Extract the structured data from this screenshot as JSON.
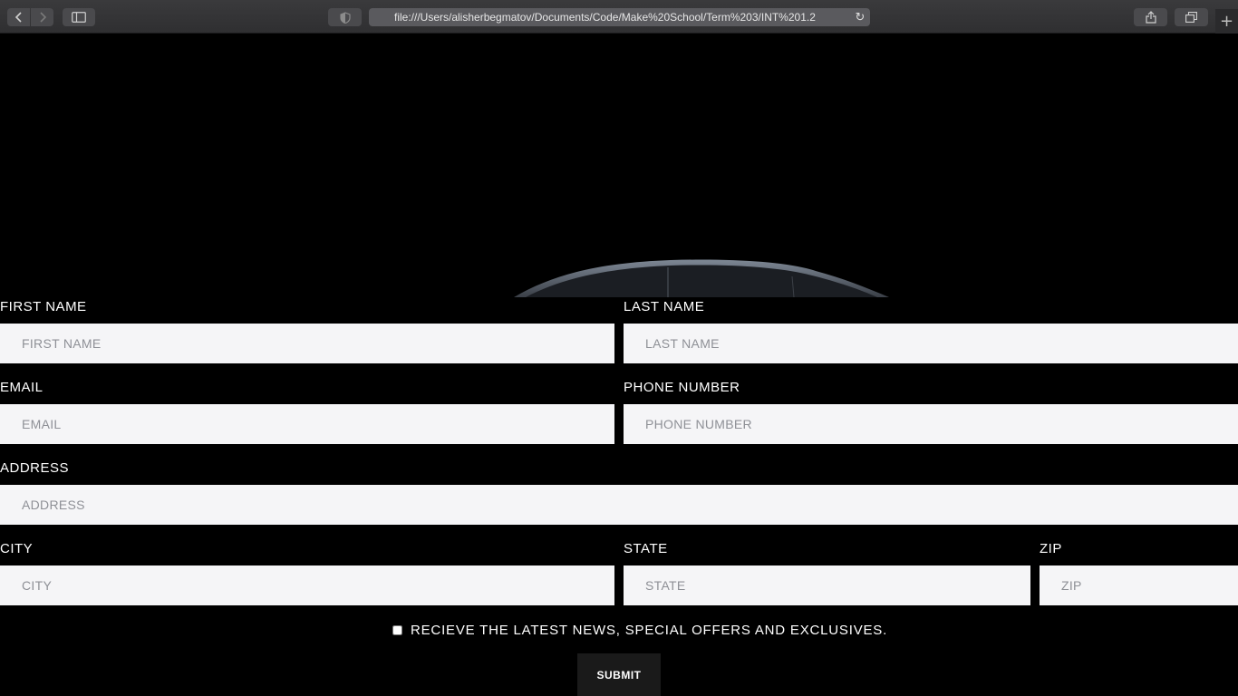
{
  "browser": {
    "url": "file:///Users/alisherbegmatov/Documents/Code/Make%20School/Term%203/INT%201.2",
    "new_tab_glyph": "+",
    "icons": [
      "back-icon",
      "forward-icon",
      "sidebar-icon",
      "shield-icon",
      "reload-icon",
      "share-icon",
      "tabs-icon",
      "plus-icon"
    ]
  },
  "form": {
    "first_name": {
      "label": "FIRST NAME",
      "placeholder": "FIRST NAME"
    },
    "last_name": {
      "label": "LAST NAME",
      "placeholder": "LAST NAME"
    },
    "email": {
      "label": "EMAIL",
      "placeholder": "EMAIL"
    },
    "phone": {
      "label": "PHONE NUMBER",
      "placeholder": "PHONE NUMBER"
    },
    "address": {
      "label": "ADDRESS",
      "placeholder": "ADDRESS"
    },
    "city": {
      "label": "CITY",
      "placeholder": "CITY"
    },
    "state": {
      "label": "STATE",
      "placeholder": "STATE"
    },
    "zip": {
      "label": "ZIP",
      "placeholder": "ZIP"
    },
    "consent_text": "RECIEVE THE LATEST NEWS, SPECIAL OFFERS AND EXCLUSIVES.",
    "consent_checked": false,
    "submit_label": "SUBMIT"
  },
  "colors": {
    "page_background": "#000000",
    "field_background": "#f5f5f7",
    "placeholder": "#8e9096",
    "submit_background": "#1a1a1a"
  }
}
